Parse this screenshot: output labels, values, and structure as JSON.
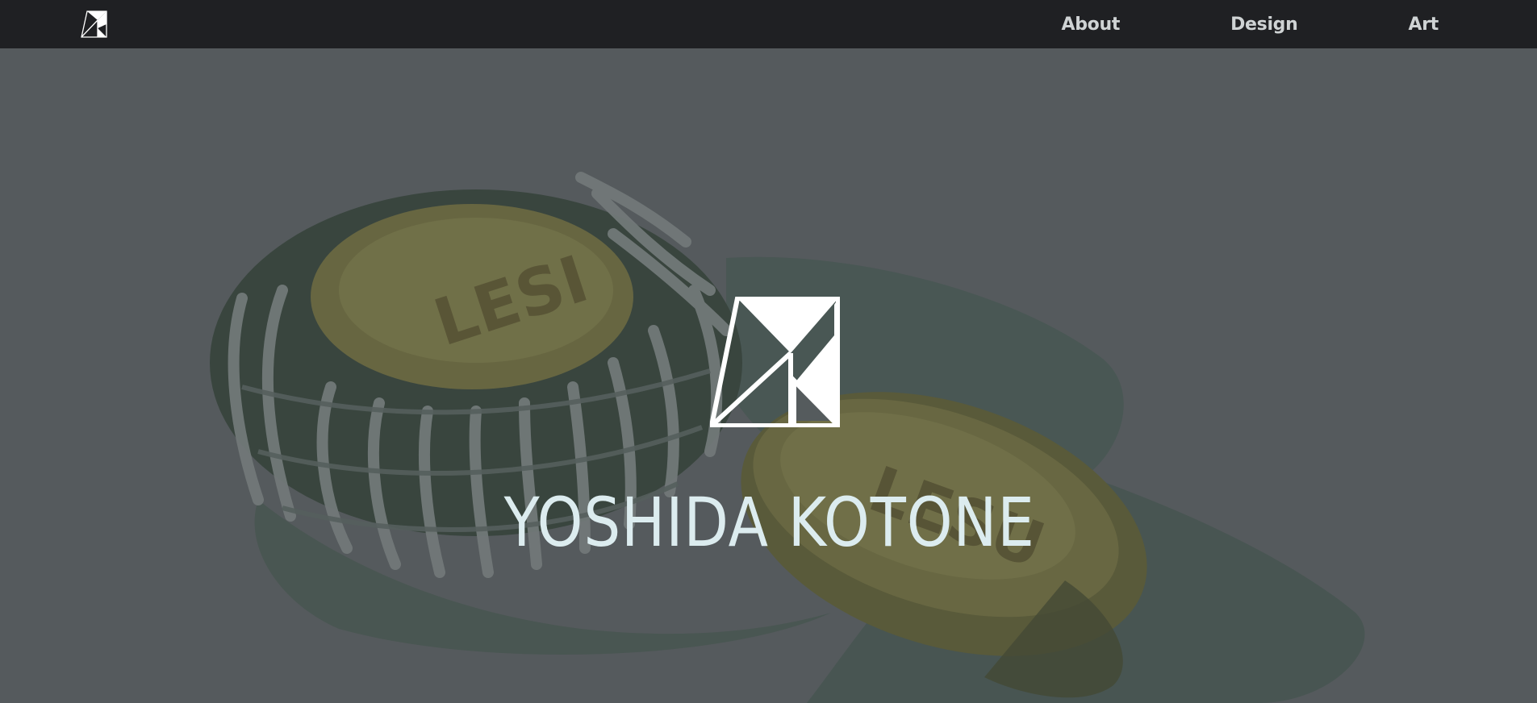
{
  "nav": {
    "logo_icon": "monogram-logo-icon",
    "links": [
      {
        "label": "About"
      },
      {
        "label": "Design"
      },
      {
        "label": "Art"
      }
    ]
  },
  "hero": {
    "title": "YOSHIDA KOTONE",
    "logo_icon": "monogram-logo-icon",
    "background_image": "painting-of-two-le-sucre-soaps-in-netting",
    "colors": {
      "overlay": "#555b5d",
      "title": "#dcecef",
      "navbar": "#1f2023",
      "nav_text": "#cfd3d4"
    }
  }
}
